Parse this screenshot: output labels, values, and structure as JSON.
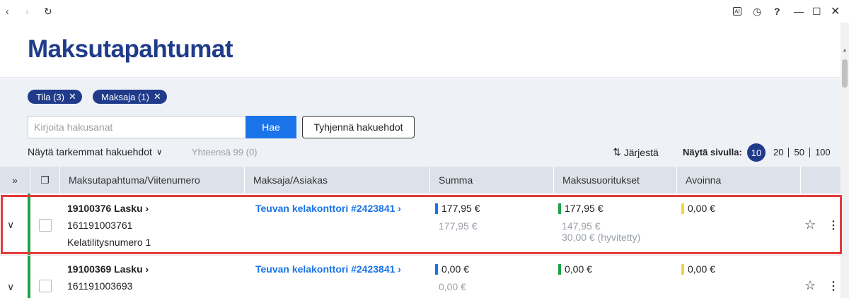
{
  "browser": {
    "back_icon": "chevron-left-icon",
    "forward_icon": "chevron-right-icon",
    "reload_icon": "reload-icon",
    "ai_label": "AI",
    "history_icon": "history-icon",
    "help_label": "?",
    "minimize_icon": "minimize-icon",
    "maximize_icon": "maximize-icon",
    "close_icon": "close-icon"
  },
  "page": {
    "title": "Maksutapahtumat"
  },
  "filters": {
    "chips": [
      {
        "label": "Tila (3)"
      },
      {
        "label": "Maksaja (1)"
      }
    ],
    "search_placeholder": "Kirjoita hakusanat",
    "search_button": "Hae",
    "clear_button": "Tyhjennä hakuehdot",
    "more_criteria": "Näytä tarkemmat hakuehdot",
    "total": "Yhteensä 99 (0)",
    "sort_label": "Järjestä",
    "per_page_label": "Näytä sivulla:",
    "per_page_options": [
      "10",
      "20",
      "50",
      "100"
    ],
    "per_page_selected": "10"
  },
  "table": {
    "columns": [
      "Maksutapahtuma/Viitenumero",
      "Maksaja/Asiakas",
      "Summa",
      "Maksusuoritukset",
      "Avoinna"
    ],
    "rows": [
      {
        "title": "19100376 Lasku",
        "reference": "161191003761",
        "extra": "Kelatilitysnumero 1",
        "payer": "Teuvan kelakonttori #2423841",
        "sum": "177,95 €",
        "sum_sub": "177,95 €",
        "payments": "177,95 €",
        "payments_sub1": "147,95 €",
        "payments_sub2": "30,00 € (hyvitetty)",
        "open": "0,00 €"
      },
      {
        "title": "19100369 Lasku",
        "reference": "161191003693",
        "payer": "Teuvan kelakonttori #2423841",
        "sum": "0,00 €",
        "sum_sub": "0,00 €",
        "payments": "0,00 €",
        "open": "0,00 €"
      }
    ]
  },
  "colors": {
    "brand": "#1f3b8a",
    "accent": "#1a73e8",
    "status_green": "#1ea14a",
    "status_yellow": "#f2d53c",
    "highlight": "#e23b3b"
  }
}
